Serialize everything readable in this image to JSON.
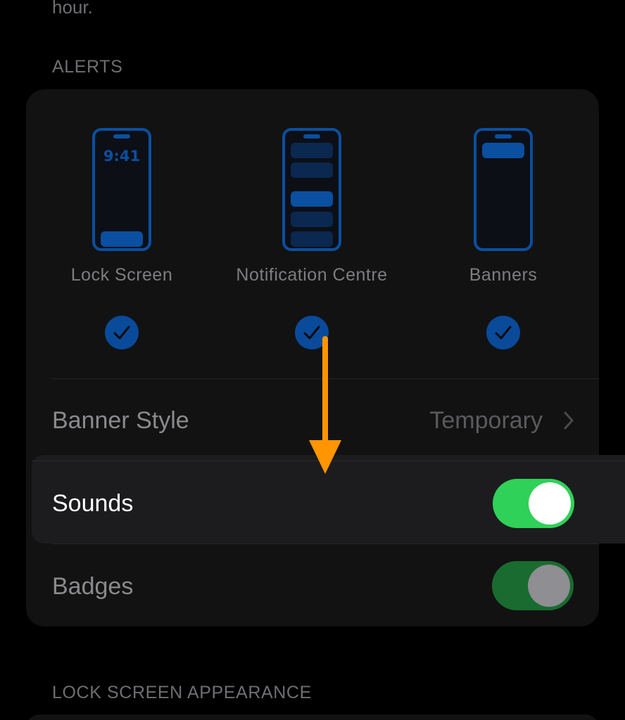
{
  "top_text": "hour.",
  "alerts_header": "ALERTS",
  "alert_styles": [
    {
      "label": "Lock Screen",
      "time": "9:41",
      "checked": true
    },
    {
      "label": "Notification Centre",
      "checked": true
    },
    {
      "label": "Banners",
      "checked": true
    }
  ],
  "banner_style": {
    "label": "Banner Style",
    "value": "Temporary"
  },
  "sounds": {
    "label": "Sounds",
    "on": true
  },
  "badges": {
    "label": "Badges",
    "on": true
  },
  "lock_screen_appearance_header": "LOCK SCREEN APPEARANCE",
  "colors": {
    "accent": "#0a4fa0",
    "toggle_on": "#30d158",
    "toggle_on_dimmed": "#1a6b30",
    "annotation_arrow": "#ff9500"
  },
  "icons": [
    "checkmark-icon",
    "chevron-right-icon",
    "arrow-down-annotation"
  ]
}
